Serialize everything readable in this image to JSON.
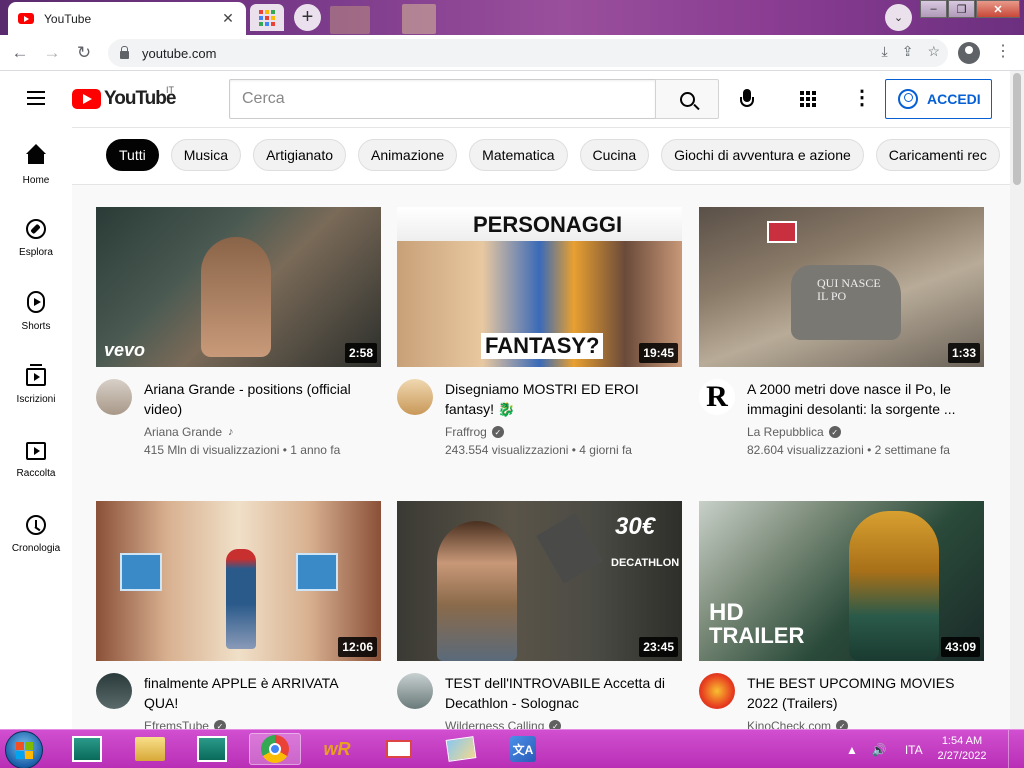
{
  "browser": {
    "tab_title": "YouTube",
    "url": "youtube.com"
  },
  "youtube": {
    "logo_text": "YouTube",
    "country_code": "IT",
    "search_placeholder": "Cerca",
    "signin_label": "ACCEDI",
    "chips": [
      "Tutti",
      "Musica",
      "Artigianato",
      "Animazione",
      "Matematica",
      "Cucina",
      "Giochi di avventura e azione",
      "Caricamenti rec"
    ],
    "guide": [
      {
        "label": "Home",
        "icon": "home-icon"
      },
      {
        "label": "Esplora",
        "icon": "explore-icon"
      },
      {
        "label": "Shorts",
        "icon": "shorts-icon"
      },
      {
        "label": "Iscrizioni",
        "icon": "subscriptions-icon"
      },
      {
        "label": "Raccolta",
        "icon": "library-icon"
      },
      {
        "label": "Cronologia",
        "icon": "history-icon"
      }
    ],
    "videos": [
      {
        "title": "Ariana Grande - positions (official video)",
        "channel": "Ariana Grande",
        "stats": "415 Mln di visualizzazioni • 1 anno fa",
        "duration": "2:58",
        "thumb_text": "vevo"
      },
      {
        "title": "Disegniamo MOSTRI ED EROI fantasy! 🐉",
        "channel": "Fraffrog",
        "stats": "243.554 visualizzazioni • 4 giorni fa",
        "duration": "19:45",
        "thumb_text_top": "PERSONAGGI",
        "thumb_text_bottom": "FANTASY?"
      },
      {
        "title": "A 2000 metri dove nasce il Po, le immagini desolanti: la sorgente ...",
        "channel": "La Repubblica",
        "stats": "82.604 visualizzazioni • 2 settimane fa",
        "duration": "1:33",
        "thumb_text": "QUI NASCE IL PO",
        "avatar_letter": "R"
      },
      {
        "title": "finalmente APPLE è ARRIVATA QUA!",
        "channel": "EfremsTube",
        "stats": "",
        "duration": "12:06"
      },
      {
        "title": "TEST dell'INTROVABILE Accetta di Decathlon - Solognac",
        "channel": "Wilderness Calling",
        "stats": "",
        "duration": "23:45",
        "thumb_text_top": "30€",
        "thumb_text_bottom": "DECATHLON"
      },
      {
        "title": "THE BEST UPCOMING MOVIES 2022 (Trailers)",
        "channel": "KinoCheck.com",
        "stats": "",
        "duration": "43:09",
        "thumb_text_top": "HD",
        "thumb_text_bottom": "TRAILER"
      }
    ]
  },
  "taskbar": {
    "language": "ITA",
    "time": "1:54 AM",
    "date": "2/27/2022"
  },
  "colors": {
    "youtube_red": "#ff0000",
    "signin_blue": "#065fd4",
    "taskbar": "#c03ec0"
  }
}
